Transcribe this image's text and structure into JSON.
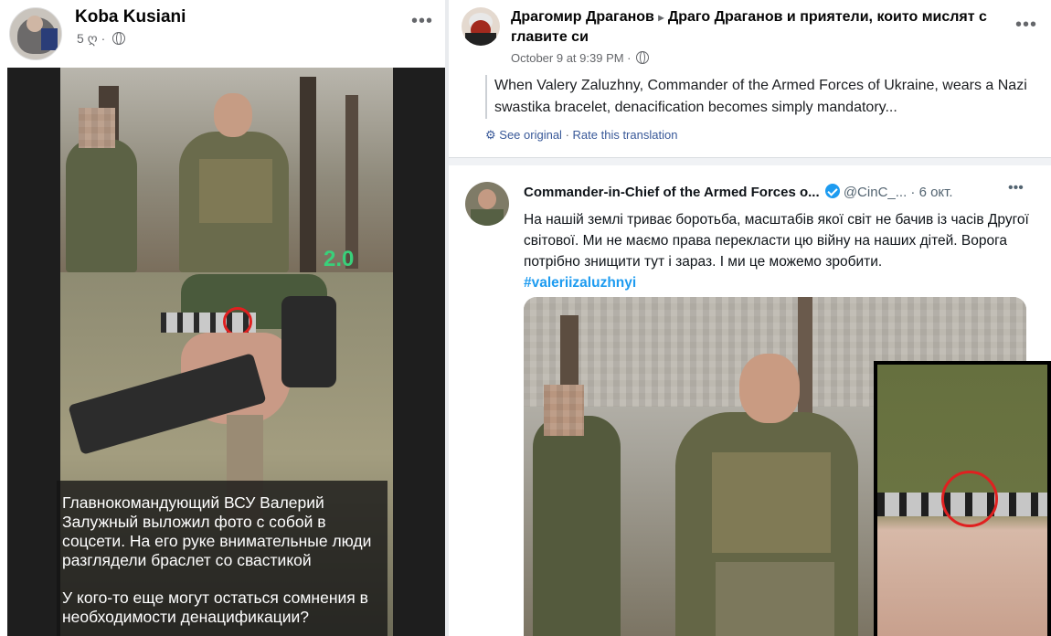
{
  "left_post": {
    "author": "Koba Kusiani",
    "time": "5 ღ",
    "watermark": "2.0",
    "caption_line1": "Главнокомандующий ВСУ Валерий Залужный выложил фото с собой в соцсети. На его руке внимательные люди разглядели браслет со свастикой",
    "caption_line2": "У кого-то еще могут остаться сомнения в необходимости денацификации?"
  },
  "right_post": {
    "author": "Драгомир Драганов",
    "group_arrow": "▸",
    "group": "Драго Драганов и приятели, които мислят с главите си",
    "time": "October 9 at 9:39 PM ·",
    "translated_text": "When Valery Zaluzhny, Commander of the Armed Forces of Ukraine, wears a Nazi swastika bracelet, denacification becomes simply mandatory...",
    "see_original": "See original",
    "separator": "·",
    "rate_translation": "Rate this translation",
    "tweet": {
      "name": "Commander-in-Chief of the Armed Forces o...",
      "handle": "@CinC_...",
      "date": "· 6 окт.",
      "text": "На нашій землі триває боротьба, масштабів якої світ не бачив із часів Другої світової. Ми не маємо права перекласти цю війну на наших дітей. Ворога потрібно знищити тут і зараз. І ми це можемо зробити.",
      "hashtag": "#valeriizaluzhnyi"
    }
  },
  "icons": {
    "more": "•••",
    "globe": "globe-icon",
    "gear": "⚙"
  }
}
